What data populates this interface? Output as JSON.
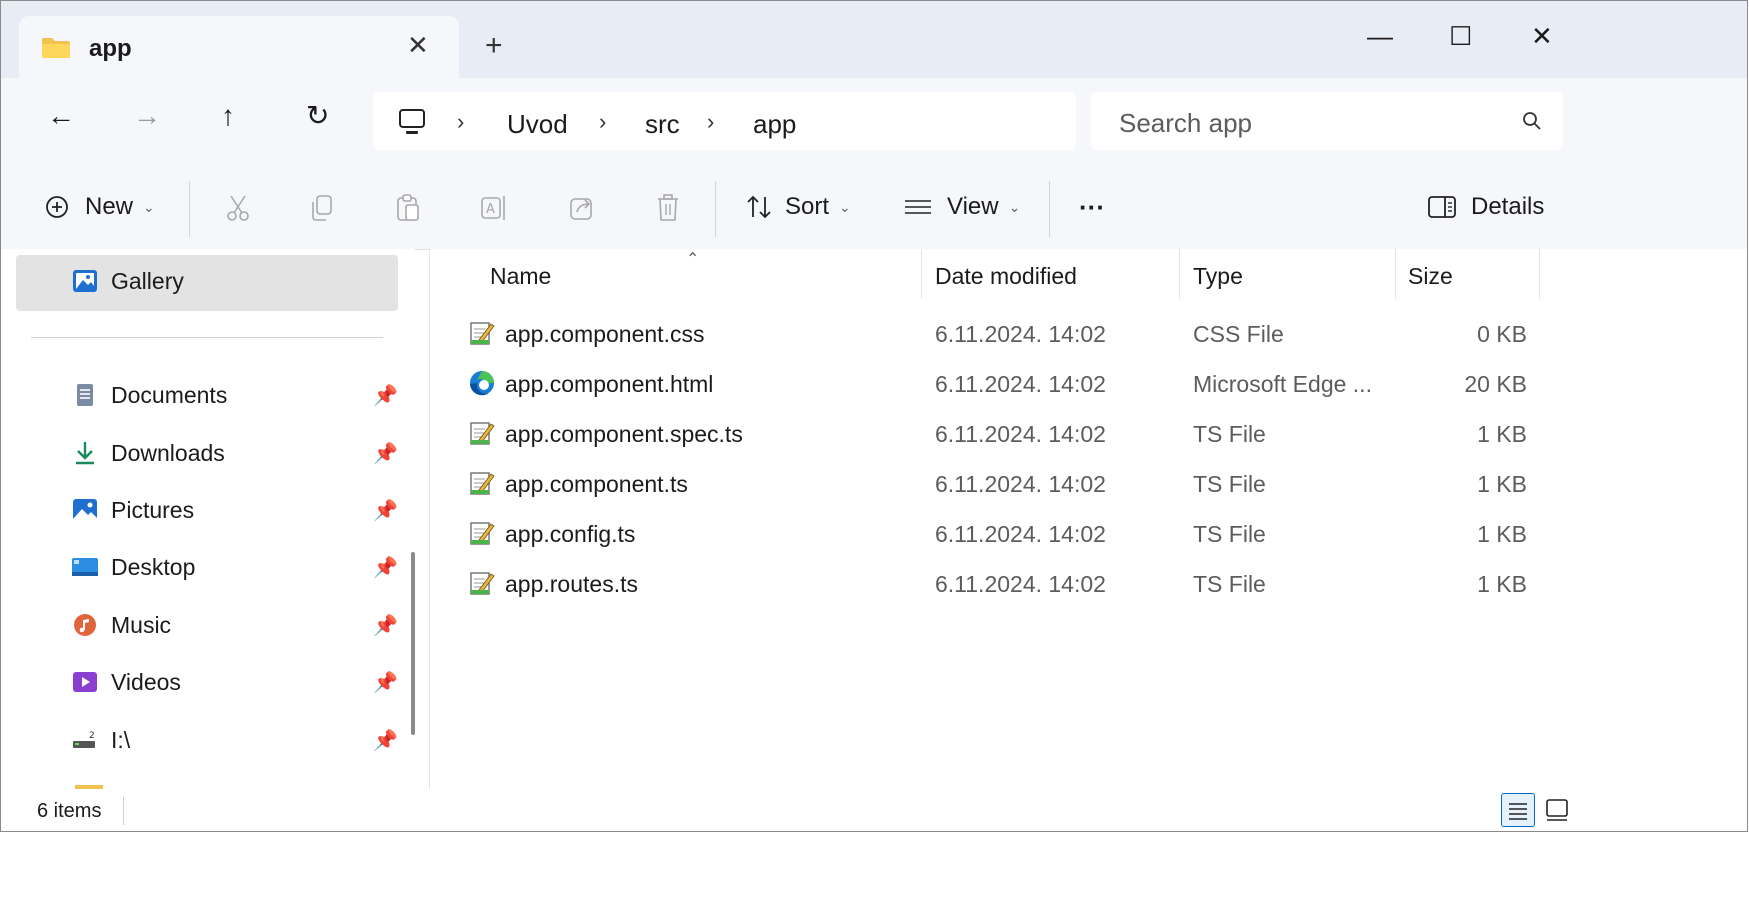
{
  "tab": {
    "title": "app",
    "close": "✕",
    "new_tab": "+"
  },
  "window_controls": {
    "minimize": "—",
    "maximize": "☐",
    "close": "✕"
  },
  "nav_buttons": {
    "back": "←",
    "forward": "→",
    "up": "↑",
    "refresh": "↻"
  },
  "breadcrumb": {
    "items": [
      "Uvod",
      "src",
      "app"
    ],
    "separator": "›"
  },
  "search": {
    "placeholder": "Search app"
  },
  "toolbar": {
    "new_label": "New",
    "sort_label": "Sort",
    "view_label": "View",
    "more_label": "···",
    "details_label": "Details",
    "chevron": "⌄"
  },
  "sidebar": {
    "selected": {
      "label": "Gallery",
      "icon": "gallery-icon"
    },
    "items": [
      {
        "label": "Documents",
        "icon": "documents-icon",
        "pinned": true
      },
      {
        "label": "Downloads",
        "icon": "downloads-icon",
        "pinned": true
      },
      {
        "label": "Pictures",
        "icon": "pictures-icon",
        "pinned": true
      },
      {
        "label": "Desktop",
        "icon": "desktop-icon",
        "pinned": true
      },
      {
        "label": "Music",
        "icon": "music-icon",
        "pinned": true
      },
      {
        "label": "Videos",
        "icon": "videos-icon",
        "pinned": true
      },
      {
        "label": "I:\\",
        "icon": "drive-icon",
        "pinned": true
      }
    ],
    "pin_glyph": "📌"
  },
  "file_list": {
    "columns": {
      "name": "Name",
      "date": "Date modified",
      "type": "Type",
      "size": "Size"
    },
    "sort_glyph": "⌃",
    "files": [
      {
        "name": "app.component.css",
        "date": "6.11.2024. 14:02",
        "type": "CSS File",
        "size": "0 KB",
        "icon": "text-file-icon"
      },
      {
        "name": "app.component.html",
        "date": "6.11.2024. 14:02",
        "type": "Microsoft Edge ...",
        "size": "20 KB",
        "icon": "edge-icon"
      },
      {
        "name": "app.component.spec.ts",
        "date": "6.11.2024. 14:02",
        "type": "TS File",
        "size": "1 KB",
        "icon": "text-file-icon"
      },
      {
        "name": "app.component.ts",
        "date": "6.11.2024. 14:02",
        "type": "TS File",
        "size": "1 KB",
        "icon": "text-file-icon"
      },
      {
        "name": "app.config.ts",
        "date": "6.11.2024. 14:02",
        "type": "TS File",
        "size": "1 KB",
        "icon": "text-file-icon"
      },
      {
        "name": "app.routes.ts",
        "date": "6.11.2024. 14:02",
        "type": "TS File",
        "size": "1 KB",
        "icon": "text-file-icon"
      }
    ]
  },
  "status": {
    "item_count": "6 items"
  },
  "colors": {
    "titlebar_bg": "#e8edf5",
    "toolbar_bg": "#f5f7fa",
    "selected_bg": "#e3e3e3",
    "accent": "#0067c0"
  }
}
